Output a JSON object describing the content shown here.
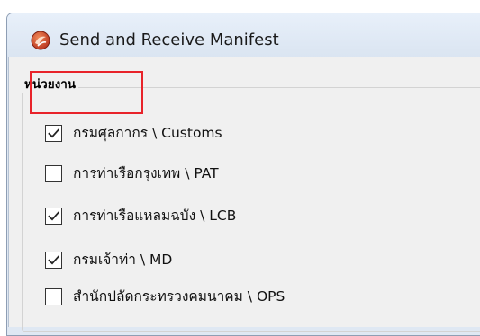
{
  "window": {
    "title": "Send and Receive Manifest"
  },
  "group": {
    "label": "หน่วยงาน"
  },
  "options": [
    {
      "label": "กรมศุลกากร \\ Customs",
      "checked": true
    },
    {
      "label": "การท่าเรือกรุงเทพ \\ PAT",
      "checked": false
    },
    {
      "label": "การท่าเรือแหลมฉบัง \\ LCB",
      "checked": true
    },
    {
      "label": "กรมเจ้าท่า \\ MD",
      "checked": true
    },
    {
      "label": "สำนักปลัดกระทรวงคมนาคม \\ OPS",
      "checked": false
    }
  ],
  "colors": {
    "highlight": "#e8232a",
    "window_frame": "#dfe8f3"
  }
}
